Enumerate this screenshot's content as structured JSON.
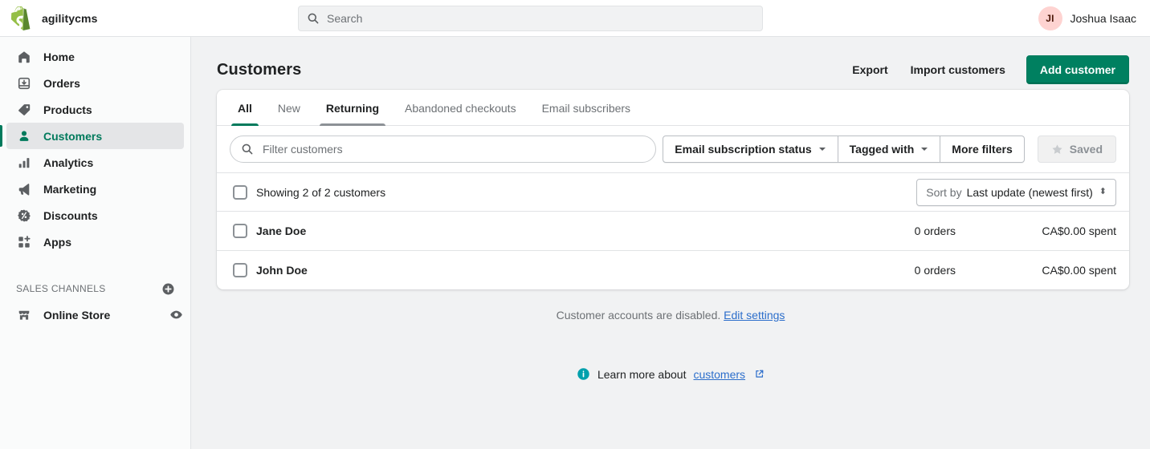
{
  "topbar": {
    "logo_icon": "shopify-bag-icon",
    "store_name": "agilitycms",
    "search": {
      "icon": "search-icon",
      "placeholder": "Search",
      "value": ""
    },
    "account": {
      "initials": "JI",
      "name": "Joshua Isaac",
      "avatar_color": "#fed3d1"
    }
  },
  "sidebar": {
    "items": [
      {
        "label": "Home",
        "icon": "home-icon",
        "active": false
      },
      {
        "label": "Orders",
        "icon": "orders-inbox-icon",
        "active": false
      },
      {
        "label": "Products",
        "icon": "product-tag-icon",
        "active": false
      },
      {
        "label": "Customers",
        "icon": "customer-person-icon",
        "active": true
      },
      {
        "label": "Analytics",
        "icon": "analytics-bars-icon",
        "active": false
      },
      {
        "label": "Marketing",
        "icon": "marketing-megaphone-icon",
        "active": false
      },
      {
        "label": "Discounts",
        "icon": "discount-percent-icon",
        "active": false
      },
      {
        "label": "Apps",
        "icon": "apps-grid-plus-icon",
        "active": false
      }
    ],
    "section": {
      "title": "SALES CHANNELS",
      "add_icon": "circle-plus-icon",
      "channels": [
        {
          "label": "Online Store",
          "icon": "storefront-icon",
          "trailing_icon": "eye-icon"
        }
      ]
    }
  },
  "page": {
    "title": "Customers",
    "actions": {
      "export": "Export",
      "import": "Import customers",
      "add": "Add customer"
    },
    "accent_color": "#008060"
  },
  "tabs": [
    {
      "label": "All",
      "state": "selected"
    },
    {
      "label": "New",
      "state": "default"
    },
    {
      "label": "Returning",
      "state": "hovered"
    },
    {
      "label": "Abandoned checkouts",
      "state": "default"
    },
    {
      "label": "Email subscribers",
      "state": "default"
    }
  ],
  "filters": {
    "search": {
      "icon": "search-icon",
      "placeholder": "Filter customers",
      "value": ""
    },
    "buttons": [
      {
        "label": "Email subscription status",
        "caret": "▾"
      },
      {
        "label": "Tagged with",
        "caret": "▾"
      },
      {
        "label": "More filters",
        "caret": ""
      }
    ],
    "saved": {
      "label": "Saved",
      "icon": "star-icon",
      "disabled": true
    }
  },
  "list": {
    "select_all_checked": false,
    "showing_text": "Showing 2 of 2 customers",
    "sort": {
      "label": "Sort by",
      "value": "Last update (newest first)",
      "icon": "updown-chevrons-icon"
    },
    "rows": [
      {
        "name": "Jane Doe",
        "orders": "0 orders",
        "spent": "CA$0.00 spent",
        "checked": false
      },
      {
        "name": "John Doe",
        "orders": "0 orders",
        "spent": "CA$0.00 spent",
        "checked": false
      }
    ]
  },
  "footer": {
    "accounts_note": "Customer accounts are disabled.",
    "accounts_link": "Edit settings",
    "learn_icon": "info-circle-icon",
    "learn_prefix": "Learn more about",
    "learn_link": "customers",
    "external_icon": "external-link-icon"
  }
}
